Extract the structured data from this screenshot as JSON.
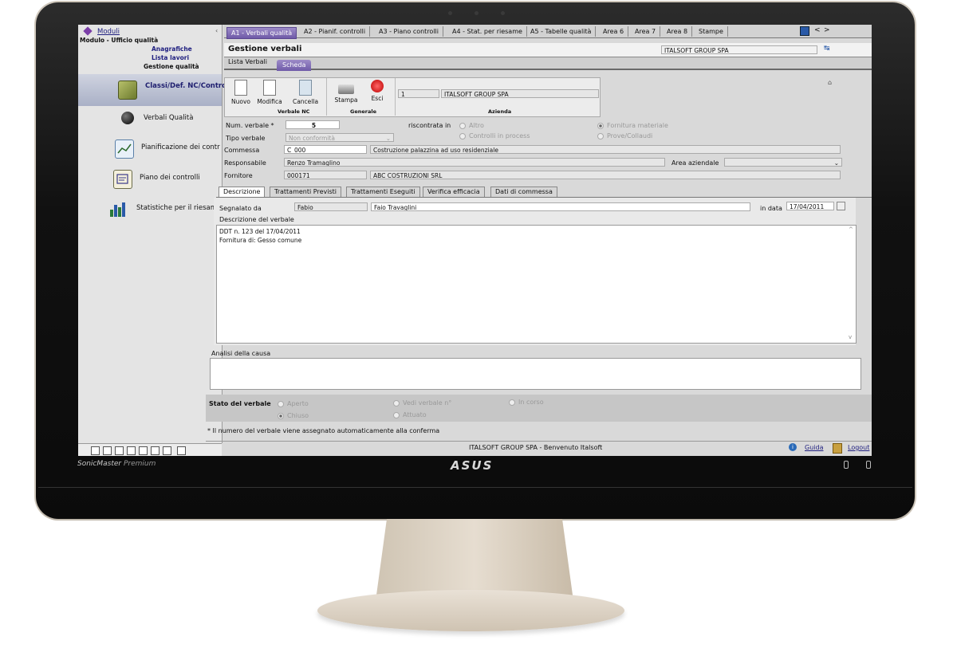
{
  "monitor": {
    "brand": "ASUS",
    "series": "SonicMaster",
    "series_suffix": "Premium"
  },
  "sidebar": {
    "title": "Moduli",
    "module": "Modulo - Ufficio qualità",
    "links": [
      "Anagrafiche",
      "Lista lavori"
    ],
    "section": "Gestione qualità",
    "items": [
      {
        "label": "Classi/Def. NC/Controlli",
        "icon": "folder-check-icon",
        "active": true
      },
      {
        "label": "Verbali Qualità",
        "icon": "bomb-icon",
        "active": false
      },
      {
        "label": "Pianificazione dei contr",
        "icon": "planning-chart-icon",
        "active": false
      },
      {
        "label": "Piano dei controlli",
        "icon": "control-plan-icon",
        "active": false
      },
      {
        "label": "Statistiche per il riesam",
        "icon": "bar-chart-icon",
        "active": false
      }
    ]
  },
  "tabs": [
    "A1 - Verbali qualità",
    "A2 - Pianif. controlli",
    "A3 - Piano controlli",
    "A4 - Stat. per riesame",
    "A5 - Tabelle qualità",
    "Area 6",
    "Area 7",
    "Area 8",
    "Stampe"
  ],
  "nav": {
    "prev": "<",
    "next": ">"
  },
  "header": {
    "title": "Gestione verbali",
    "company": "ITALSOFT GROUP SPA"
  },
  "subtabs": [
    "Lista Verbali",
    "Scheda"
  ],
  "toolbar": {
    "buttons": {
      "new": "Nuovo",
      "edit": "Modifica",
      "delete": "Cancella",
      "print": "Stampa",
      "exit": "Esci"
    },
    "groups": {
      "verbale": "Verbale NC",
      "generale": "Generale",
      "azienda": "Azienda"
    },
    "azienda_code": "1",
    "azienda_name": "ITALSOFT GROUP SPA"
  },
  "form": {
    "num_label": "Num. verbale *",
    "num_value": "5",
    "tipo_label": "Tipo verbale",
    "tipo_value": "Non conformità",
    "commessa_label": "Commessa",
    "commessa_code": "C_000",
    "commessa_desc": "Costruzione palazzina ad uso residenziale",
    "resp_label": "Responsabile",
    "resp_value": "Renzo Tramaglino",
    "area_label": "Area aziendale",
    "forn_label": "Fornitore",
    "forn_code": "000171",
    "forn_name": "ABC COSTRUZIONI SRL",
    "riscontrata_label": "riscontrata in",
    "riscontrata_options": [
      {
        "label": "Altro",
        "on": false
      },
      {
        "label": "Controlli in process",
        "on": false
      },
      {
        "label": "Fornitura materiale",
        "on": true
      },
      {
        "label": "Prove/Collaudi",
        "on": false
      }
    ]
  },
  "inner_tabs": [
    "Descrizione",
    "Trattamenti Previsti",
    "Trattamenti Eseguiti",
    "Verifica efficacia",
    "Dati di commessa"
  ],
  "descrizione": {
    "segnalato_label": "Segnalato da",
    "segnalato_code": "Fabio",
    "segnalato_name": "Faio Travaglini",
    "data_label": "in data",
    "data_value": "17/04/2011",
    "desc_label": "Descrizione del verbale",
    "desc_line1": "DDT n. 123 del 17/04/2011",
    "desc_line2": "Fornitura di: Gesso comune",
    "analisi_label": "Analisi della causa"
  },
  "stato": {
    "label": "Stato del verbale",
    "options": [
      {
        "label": "Aperto",
        "on": false
      },
      {
        "label": "Chiuso",
        "on": true
      },
      {
        "label": "Vedi verbale n°",
        "on": false
      },
      {
        "label": "Attuato",
        "on": false
      },
      {
        "label": "In corso",
        "on": false
      }
    ]
  },
  "note": "* Il numero del verbale viene assegnato automaticamente alla conferma",
  "status_bar": {
    "text": "ITALSOFT GROUP SPA - Benvenuto Italsoft",
    "help": "Guida",
    "logout": "Logout"
  }
}
